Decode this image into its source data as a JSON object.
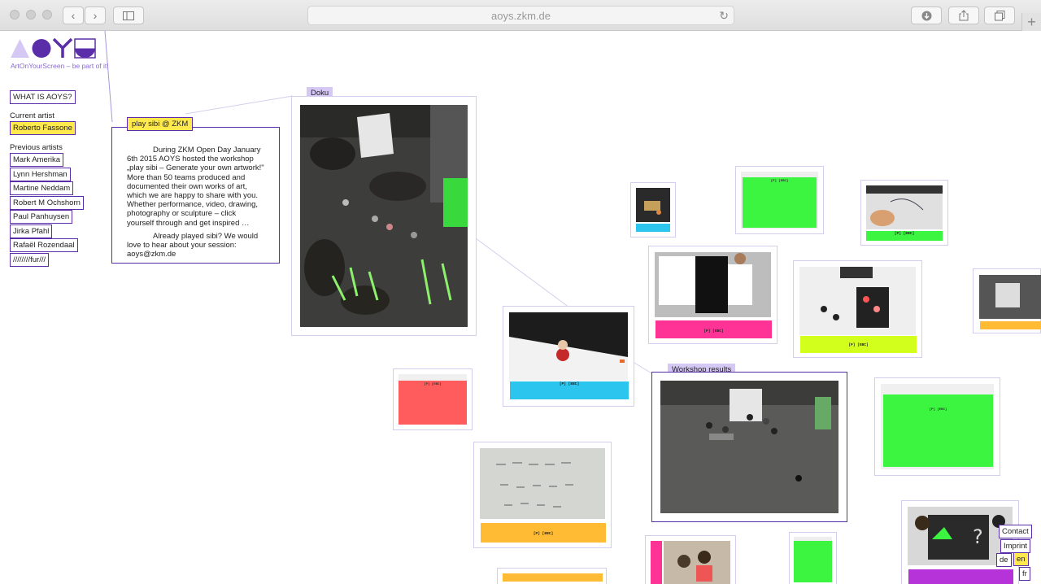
{
  "browser": {
    "url": "aoys.zkm.de",
    "icons": {
      "back": "chevron-left-icon",
      "forward": "chevron-right-icon",
      "sidebar": "sidebar-icon",
      "reload": "reload-icon",
      "download": "download-icon",
      "share": "share-icon",
      "tabs": "tabs-icon",
      "new_tab": "plus-icon"
    }
  },
  "site": {
    "logo": "AOYS",
    "tagline": "ArtOnYourScreen – be part of it!",
    "what_is": "WHAT IS AOYS?",
    "current_artist_label": "Current artist",
    "current_artist": "Roberto Fassone",
    "previous_artists_label": "Previous artists",
    "previous_artists": [
      "Mark Amerika",
      "Lynn Hershman",
      "Martine Neddam",
      "Robert M Ochshorn",
      "Paul Panhuysen",
      "Jirka Pfahl",
      "Rafaël Rozendaal",
      "////////fur///"
    ],
    "accent": "#5a2ea8",
    "highlight": "#ffe94d"
  },
  "info": {
    "tag": "play sibi @ ZKM",
    "para1": "During ZKM Open Day January 6th 2015 AOYS hosted the workshop „play sibi – Generate your own artwork!\" More than 50 teams produced and documented their own works of art, which we are happy to share with you. Whether performance, video, drawing, photography or sculpture – click yourself through and get inspired …",
    "para2": "Already played sibi? We would love to hear about your session: aoys@zkm.de"
  },
  "labels": {
    "doku": "Doku",
    "workshop": "Workshop results"
  },
  "card_caption": "[P] [EBC]",
  "footer": {
    "contact": "Contact",
    "imprint": "Imprint",
    "languages": [
      "de",
      "en",
      "fr"
    ],
    "active_language": "en"
  }
}
